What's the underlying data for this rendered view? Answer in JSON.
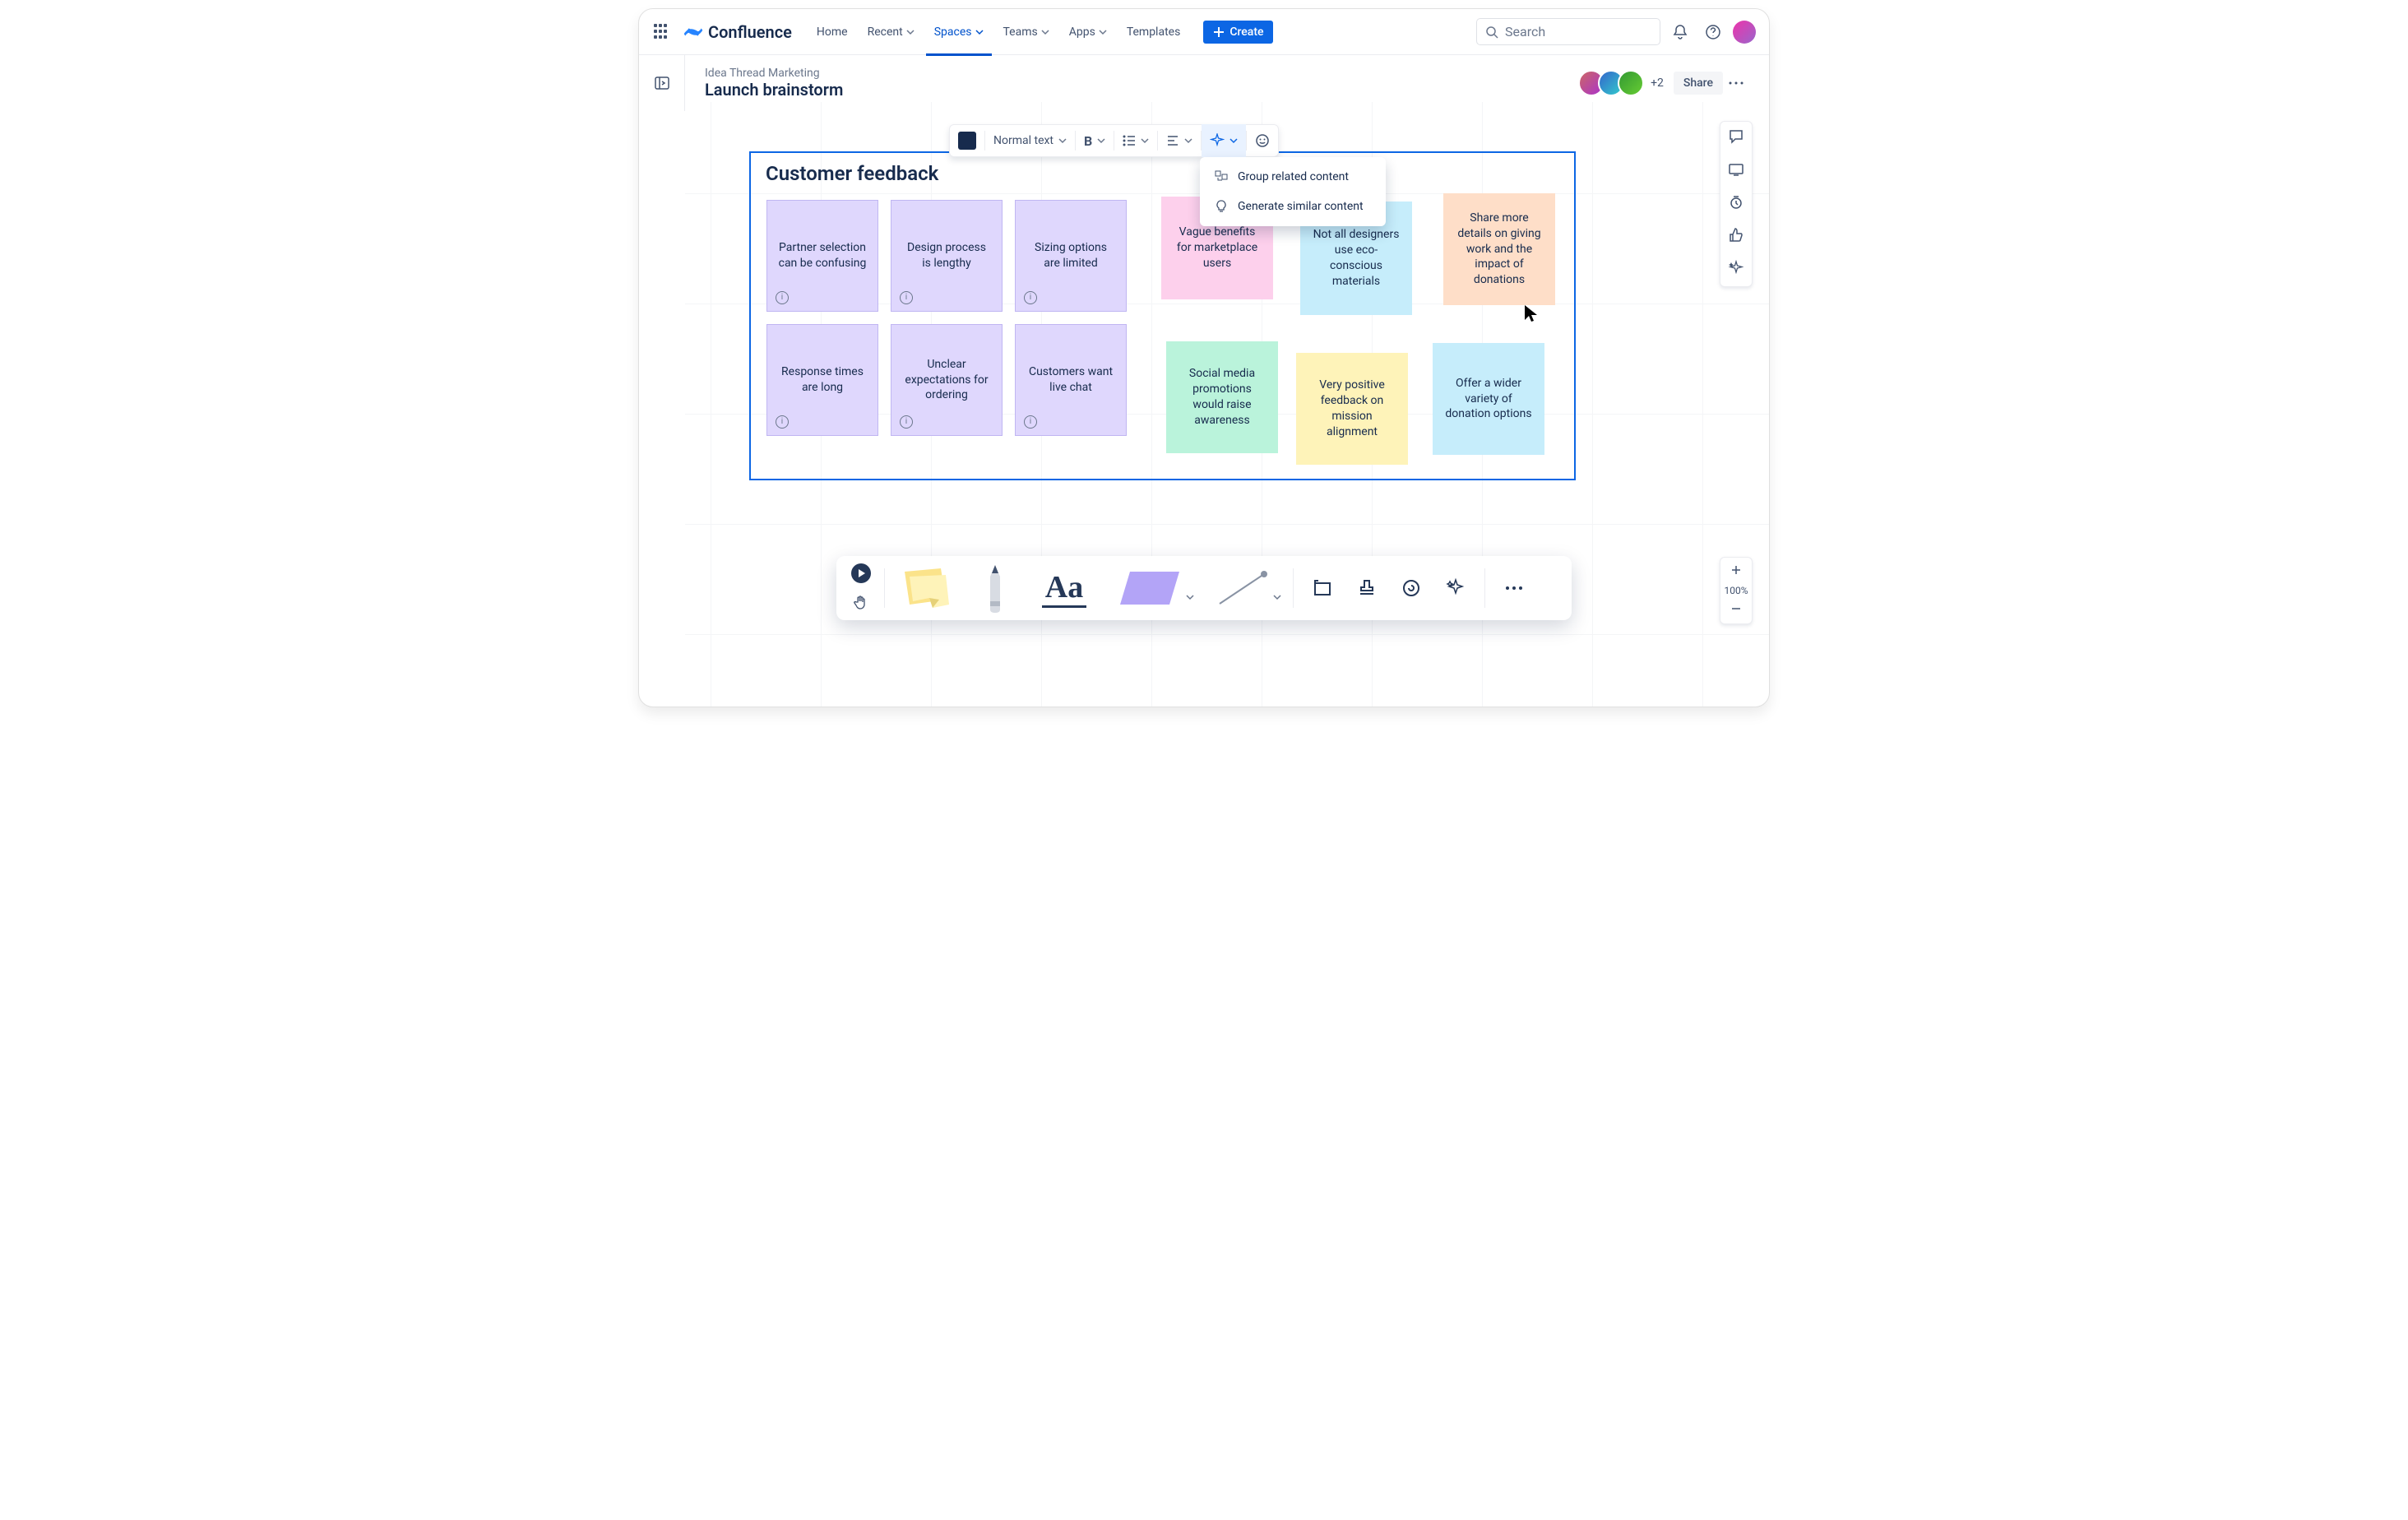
{
  "nav": {
    "product": "Confluence",
    "items": [
      {
        "label": "Home",
        "dropdown": false
      },
      {
        "label": "Recent",
        "dropdown": true
      },
      {
        "label": "Spaces",
        "dropdown": true,
        "active": true
      },
      {
        "label": "Teams",
        "dropdown": true
      },
      {
        "label": "Apps",
        "dropdown": true
      },
      {
        "label": "Templates",
        "dropdown": false
      }
    ],
    "create": "Create",
    "search_placeholder": "Search"
  },
  "page": {
    "breadcrumb": "Idea Thread Marketing",
    "title": "Launch brainstorm",
    "plus_count": "+2",
    "share": "Share"
  },
  "editor_toolbar": {
    "format_label": "Normal text"
  },
  "ai_menu": {
    "group": "Group related content",
    "generate": "Generate similar content"
  },
  "section_title": "Customer feedback",
  "stickies": {
    "p1": "Partner selection can be confusing",
    "p2": "Design process is lengthy",
    "p3": "Sizing options are limited",
    "p4": "Response times are long",
    "p5": "Unclear expectations for ordering",
    "p6": "Customers want live chat",
    "s1": "Vague benefits for marketplace users",
    "s2": "Not all designers use eco-conscious materials",
    "s3": "Share more details on giving work and the impact of donations",
    "s4": "Social media promotions would raise awareness",
    "s5": "Very positive feedback on mission alignment",
    "s6": "Offer a wider variety of donation options"
  },
  "zoom": "100%"
}
